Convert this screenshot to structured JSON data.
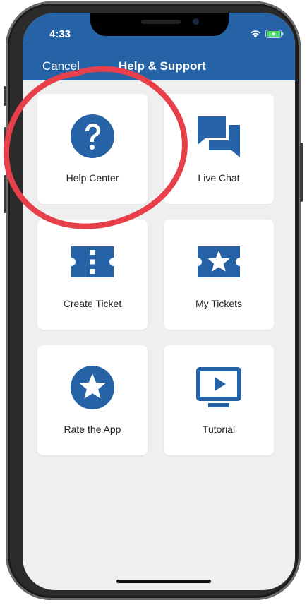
{
  "status_bar": {
    "time": "4:33"
  },
  "header": {
    "cancel_label": "Cancel",
    "title": "Help & Support"
  },
  "tiles": [
    {
      "label": "Help Center",
      "icon": "question-circle-icon"
    },
    {
      "label": "Live Chat",
      "icon": "chat-bubbles-icon"
    },
    {
      "label": "Create Ticket",
      "icon": "ticket-icon"
    },
    {
      "label": "My Tickets",
      "icon": "star-ticket-icon"
    },
    {
      "label": "Rate the App",
      "icon": "star-circle-icon"
    },
    {
      "label": "Tutorial",
      "icon": "video-monitor-icon"
    }
  ],
  "colors": {
    "brand": "#2563a6",
    "highlight": "#e8404a",
    "background": "#efefef"
  }
}
